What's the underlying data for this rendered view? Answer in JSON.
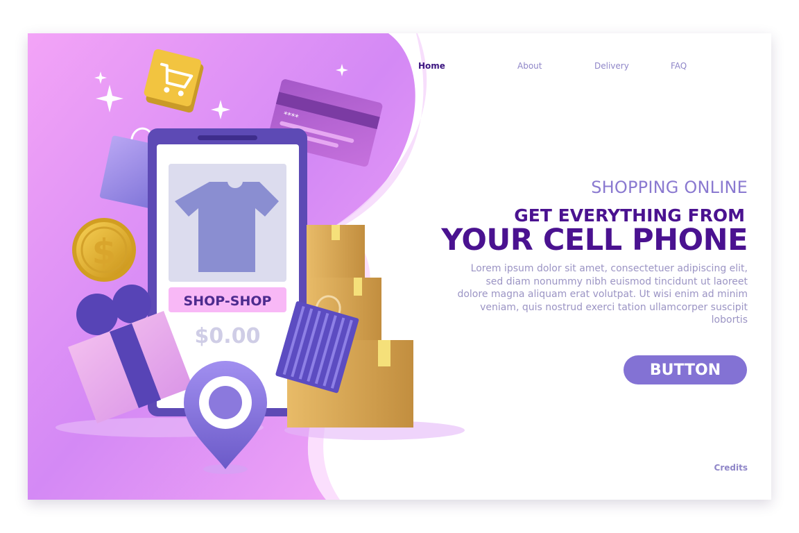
{
  "nav": {
    "home": "Home",
    "about": "About",
    "delivery": "Delivery",
    "faq": "FAQ"
  },
  "hero": {
    "kicker": "SHOPPING ONLINE",
    "line1": "GET EVERYTHING FROM",
    "line2": "YOUR CELL PHONE",
    "body": "Lorem ipsum dolor sit amet, consectetuer adipiscing elit, sed diam nonummy nibh euismod tincidunt ut laoreet dolore magna aliquam erat volutpat. Ut wisi enim ad minim veniam, quis nostrud exerci tation ullamcorper suscipit lobortis",
    "button": "BUTTON"
  },
  "phone": {
    "store_name": "SHOP-SHOP",
    "price": "$0.00"
  },
  "card_number": "****",
  "coin_symbol": "$",
  "footer": {
    "credits": "Credits"
  },
  "colors": {
    "accent": "#8372d4",
    "heading": "#4a1290",
    "pink_bg": "#e99cf6",
    "phone_frame": "#5d4ab5"
  }
}
